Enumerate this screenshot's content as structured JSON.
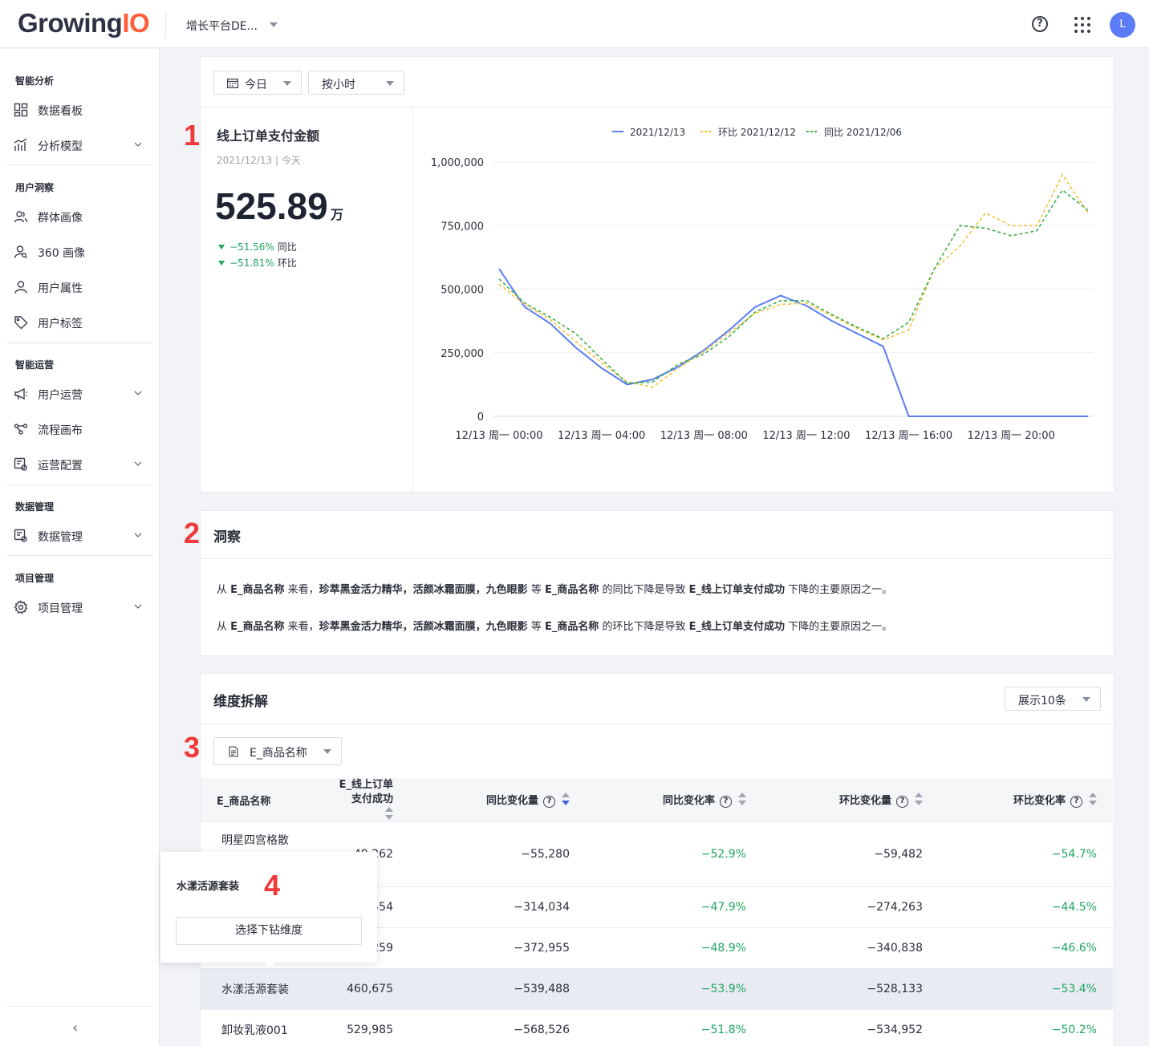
{
  "topbar": {
    "logo_main": "Growing",
    "logo_accent": "IO",
    "project_name": "增长平台DE...",
    "help_glyph": "?",
    "avatar_initial": "L"
  },
  "sidebar": {
    "sections": [
      {
        "title": "智能分析",
        "items": [
          {
            "label": "数据看板",
            "icon": "dashboard-icon",
            "has_chevron": false
          },
          {
            "label": "分析模型",
            "icon": "bar-chart-icon",
            "has_chevron": true
          }
        ]
      },
      {
        "title": "用户洞察",
        "items": [
          {
            "label": "群体画像",
            "icon": "users-icon",
            "has_chevron": false
          },
          {
            "label": "360 画像",
            "icon": "user-search-icon",
            "has_chevron": false
          },
          {
            "label": "用户属性",
            "icon": "user-icon",
            "has_chevron": false
          },
          {
            "label": "用户标签",
            "icon": "tag-icon",
            "has_chevron": false
          }
        ]
      },
      {
        "title": "智能运营",
        "items": [
          {
            "label": "用户运营",
            "icon": "megaphone-icon",
            "has_chevron": true
          },
          {
            "label": "流程画布",
            "icon": "flow-icon",
            "has_chevron": false
          },
          {
            "label": "运营配置",
            "icon": "config-icon",
            "has_chevron": true
          }
        ]
      },
      {
        "title": "数据管理",
        "items": [
          {
            "label": "数据管理",
            "icon": "data-manage-icon",
            "has_chevron": true
          }
        ]
      },
      {
        "title": "项目管理",
        "items": [
          {
            "label": "项目管理",
            "icon": "gear-icon",
            "has_chevron": true
          }
        ]
      }
    ],
    "collapse_glyph": "‹"
  },
  "annotations": [
    "1",
    "2",
    "3",
    "4"
  ],
  "filters": {
    "date_label": "今日",
    "granularity_label": "按小时"
  },
  "metric": {
    "title": "线上订单支付金额",
    "date_text": "2021/12/13 | 今天",
    "value": "525.89",
    "unit": "万",
    "yoy_pct": "−51.56%",
    "yoy_label": "同比",
    "mom_pct": "−51.81%",
    "mom_label": "环比"
  },
  "chart_data": {
    "type": "line",
    "x": [
      "00:00",
      "01:00",
      "02:00",
      "03:00",
      "04:00",
      "05:00",
      "06:00",
      "07:00",
      "08:00",
      "09:00",
      "10:00",
      "11:00",
      "12:00",
      "13:00",
      "14:00",
      "15:00",
      "16:00",
      "17:00",
      "18:00",
      "19:00",
      "20:00",
      "21:00",
      "22:00",
      "23:00"
    ],
    "x_tick_labels": [
      "12/13 周一 00:00",
      "12/13 周一 04:00",
      "12/13 周一 08:00",
      "12/13 周一 12:00",
      "12/13 周一 16:00",
      "12/13 周一 20:00"
    ],
    "y_tick_labels": [
      "1,000,000",
      "750,000",
      "500,000",
      "250,000",
      "0"
    ],
    "ylim": [
      0,
      1000000
    ],
    "legend_position": "top",
    "series": [
      {
        "name": "2021/12/13",
        "color": "#5b7cf6",
        "dash": false,
        "values": [
          580000,
          430000,
          365000,
          270000,
          190000,
          125000,
          145000,
          195000,
          260000,
          340000,
          430000,
          475000,
          435000,
          375000,
          325000,
          275000,
          0,
          0,
          0,
          0,
          0,
          0,
          0,
          0
        ]
      },
      {
        "name": "环比 2021/12/12",
        "color": "#f5c33b",
        "dash": true,
        "values": [
          520000,
          440000,
          380000,
          295000,
          210000,
          135000,
          115000,
          190000,
          255000,
          330000,
          405000,
          440000,
          445000,
          395000,
          345000,
          300000,
          340000,
          580000,
          670000,
          800000,
          750000,
          750000,
          950000,
          800000
        ]
      },
      {
        "name": "同比 2021/12/06",
        "color": "#3fae49",
        "dash": true,
        "values": [
          540000,
          445000,
          390000,
          325000,
          225000,
          130000,
          135000,
          205000,
          245000,
          315000,
          410000,
          455000,
          455000,
          400000,
          350000,
          305000,
          370000,
          580000,
          750000,
          740000,
          710000,
          730000,
          890000,
          810000
        ]
      }
    ]
  },
  "insight": {
    "title": "洞察",
    "lines": [
      {
        "pre": "从 ",
        "dim": "E_商品名称",
        "mid1": " 来看，",
        "items": "珍萃黑金活力精华，活颜冰霜面膜，九色眼影",
        "mid2": " 等 ",
        "dim2": "E_商品名称",
        "mid3": " 的同比下降是导致 ",
        "metric": "E_线上订单支付成功",
        "post": " 下降的主要原因之一。"
      },
      {
        "pre": "从 ",
        "dim": "E_商品名称",
        "mid1": " 来看，",
        "items": "珍萃黑金活力精华，活颜冰霜面膜，九色眼影",
        "mid2": " 等 ",
        "dim2": "E_商品名称",
        "mid3": " 的环比下降是导致 ",
        "metric": "E_线上订单支付成功",
        "post": " 下降的主要原因之一。"
      }
    ]
  },
  "dimension": {
    "title": "维度拆解",
    "show_count": "展示10条",
    "dimension_select": "E_商品名称",
    "columns": [
      "E_商品名称",
      "E_线上订单\n支付成功",
      "同比变化量",
      "同比变化率",
      "环比变化量",
      "环比变化率"
    ],
    "rows": [
      {
        "name": "明星四宫格散",
        "value": "49,262",
        "yoy": "−55,280",
        "yoy_rate": "−52.9%",
        "mom": "−59,482",
        "mom_rate": "−54.7%"
      },
      {
        "name": "",
        "value": "341,454",
        "yoy": "−314,034",
        "yoy_rate": "−47.9%",
        "mom": "−274,263",
        "mom_rate": "−44.5%"
      },
      {
        "name": "",
        "value": "390,259",
        "yoy": "−372,955",
        "yoy_rate": "−48.9%",
        "mom": "−340,838",
        "mom_rate": "−46.6%"
      },
      {
        "name": "水漾活源套装",
        "value": "460,675",
        "yoy": "−539,488",
        "yoy_rate": "−53.9%",
        "mom": "−528,133",
        "mom_rate": "−53.4%"
      },
      {
        "name": "卸妆乳液001",
        "value": "529,985",
        "yoy": "−568,526",
        "yoy_rate": "−51.8%",
        "mom": "−534,952",
        "mom_rate": "−50.2%"
      }
    ]
  },
  "popover": {
    "title": "水漾活源套装",
    "button_label": "选择下钻维度"
  }
}
